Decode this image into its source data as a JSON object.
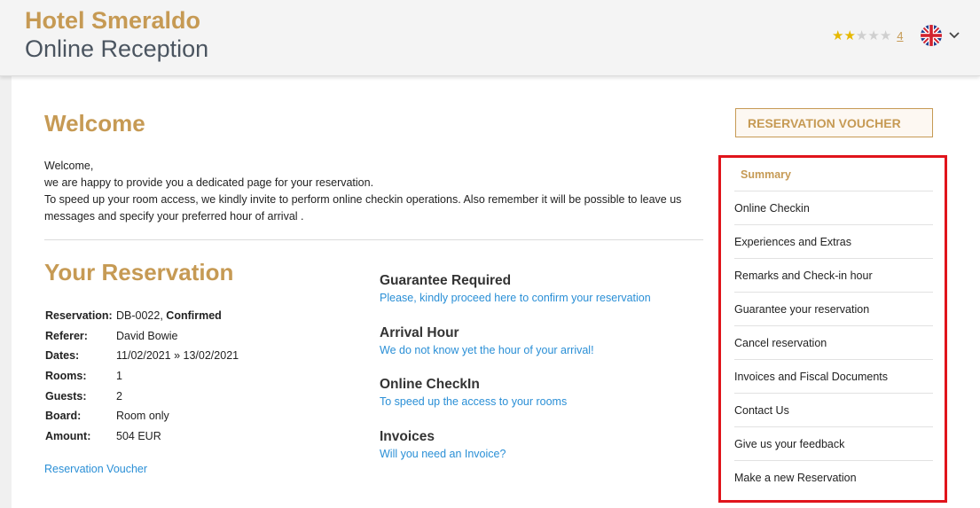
{
  "header": {
    "hotel_name": "Hotel Smeraldo",
    "subtitle": "Online Reception",
    "rating": {
      "filled_stars": 2,
      "total_stars": 5,
      "count": "4"
    },
    "language_flag": "uk-flag-icon"
  },
  "welcome": {
    "title": "Welcome",
    "lines": [
      "Welcome,",
      "we are happy to provide you a dedicated page for your reservation.",
      "To speed up your room access, we kindly invite to perform online checkin operations. Also remember it will be possible to leave us messages and specify your preferred hour of arrival ."
    ]
  },
  "reservation": {
    "title": "Your Reservation",
    "rows": [
      {
        "label": "Reservation:",
        "value": "DB-0022,",
        "value_bold": "Confirmed"
      },
      {
        "label": "Referer:",
        "value": "David Bowie"
      },
      {
        "label": "Dates:",
        "value": "11/02/2021 » 13/02/2021"
      },
      {
        "label": "Rooms:",
        "value": "1"
      },
      {
        "label": "Guests:",
        "value": "2"
      },
      {
        "label": "Board:",
        "value": "Room only"
      },
      {
        "label": "Amount:",
        "value": "504 EUR"
      }
    ],
    "voucher_link": "Reservation Voucher"
  },
  "info_blocks": [
    {
      "title": "Guarantee Required",
      "link": "Please, kindly proceed here to confirm your reservation"
    },
    {
      "title": "Arrival Hour",
      "link": "We do not know yet the hour of your arrival!"
    },
    {
      "title": "Online CheckIn",
      "link": "To speed up the access to your rooms"
    },
    {
      "title": "Invoices",
      "link": "Will you need an Invoice?"
    }
  ],
  "sidebar": {
    "voucher_button": "RESERVATION VOUCHER",
    "items": [
      "Summary",
      "Online Checkin",
      "Experiences and Extras",
      "Remarks and Check-in hour",
      "Guarantee your reservation",
      "Cancel reservation",
      "Invoices and Fiscal Documents",
      "Contact Us",
      "Give us your feedback",
      "Make a new Reservation"
    ]
  },
  "colors": {
    "brand_gold": "#c69a54",
    "link_blue": "#2a8fd6",
    "highlight_red": "#e0141b"
  }
}
